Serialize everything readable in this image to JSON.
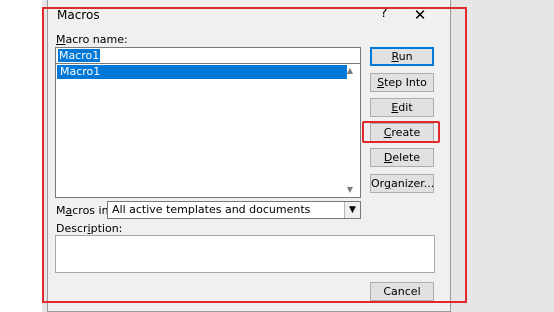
{
  "dialog": {
    "title": "Macros",
    "help_glyph": "?",
    "close_glyph": "✕"
  },
  "macro_name": {
    "label_prefix": "",
    "label_underlined": "M",
    "label_rest": "acro name:",
    "value": "Macro1"
  },
  "macro_list": {
    "items": [
      "Macro1"
    ],
    "selected": "Macro1",
    "scroll_up_glyph": "▲",
    "scroll_down_glyph": "▼"
  },
  "macros_in": {
    "label_prefix": "M",
    "label_underlined": "a",
    "label_rest": "cros in:",
    "value": "All active templates and documents",
    "arrow_glyph": "▼"
  },
  "description": {
    "label_prefix": "Descr",
    "label_underlined": "i",
    "label_rest": "ption:",
    "value": ""
  },
  "buttons": {
    "run": {
      "u": "R",
      "rest": "un"
    },
    "step_into": {
      "u": "S",
      "rest": "tep Into"
    },
    "edit": {
      "u": "E",
      "rest": "dit"
    },
    "create": {
      "u": "C",
      "rest": "reate"
    },
    "delete": {
      "u": "D",
      "rest": "elete"
    },
    "organizer": {
      "pre": "Or",
      "u": "g",
      "rest": "anizer..."
    },
    "cancel": "Cancel"
  },
  "colors": {
    "selection": "#0078d7",
    "annotation_red": "#e0292b",
    "dialog_bg": "#f0f0f0"
  }
}
